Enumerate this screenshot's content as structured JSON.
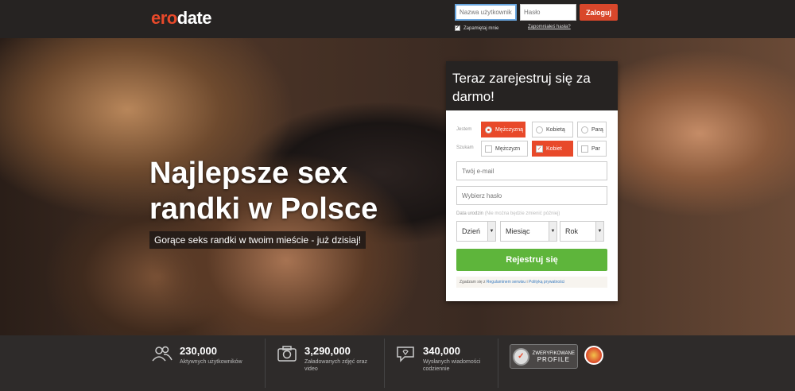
{
  "header": {
    "logo_part1": "ero",
    "logo_part2": "date",
    "username_placeholder": "Nazwa użytkownika",
    "password_placeholder": "Hasło",
    "login_label": "Zaloguj",
    "remember_label": "Zapamiętaj mnie",
    "forgot_label": "Zapomniałeś hasła?"
  },
  "hero": {
    "title": "Najlepsze sex randki w Polsce",
    "subtitle": "Gorące seks randki w twoim mieście - już dzisiaj!"
  },
  "registration": {
    "heading": "Teraz zarejestruj się za darmo!",
    "iam_label": "Jestem",
    "seeking_label": "Szukam",
    "iam_options": [
      {
        "label": "Mężczyzną",
        "selected": true
      },
      {
        "label": "Kobietą",
        "selected": false
      },
      {
        "label": "Parą",
        "selected": false
      }
    ],
    "seeking_options": [
      {
        "label": "Mężczyzn",
        "selected": false
      },
      {
        "label": "Kobiet",
        "selected": true
      },
      {
        "label": "Par",
        "selected": false
      }
    ],
    "email_placeholder": "Twój e-mail",
    "password_placeholder": "Wybierz hasło",
    "dob_label": "Data urodzin",
    "dob_note": "(Nie można będzie zmienić później)",
    "day_label": "Dzień",
    "month_label": "Miesiąc",
    "year_label": "Rok",
    "submit_label": "Rejestruj się",
    "agree_prefix": "Zgadzam się z",
    "terms_link": "Regulaminem serwisu",
    "agree_and": "i",
    "privacy_link": "Polityką prywatności"
  },
  "stats": [
    {
      "icon": "users-icon",
      "value": "230,000",
      "label": "Aktywnych użytkowników"
    },
    {
      "icon": "camera-icon",
      "value": "3,290,000",
      "label": "Załadowanych zdjęć oraz video"
    },
    {
      "icon": "chat-icon",
      "value": "340,000",
      "label": "Wysłanych wiadomości codziennie"
    }
  ],
  "badge": {
    "line1": "ZWERYFIKOWANE",
    "line2": "PROFILE"
  },
  "colors": {
    "brand": "#e8492a",
    "submit": "#5eb53b",
    "dark": "#262322"
  }
}
